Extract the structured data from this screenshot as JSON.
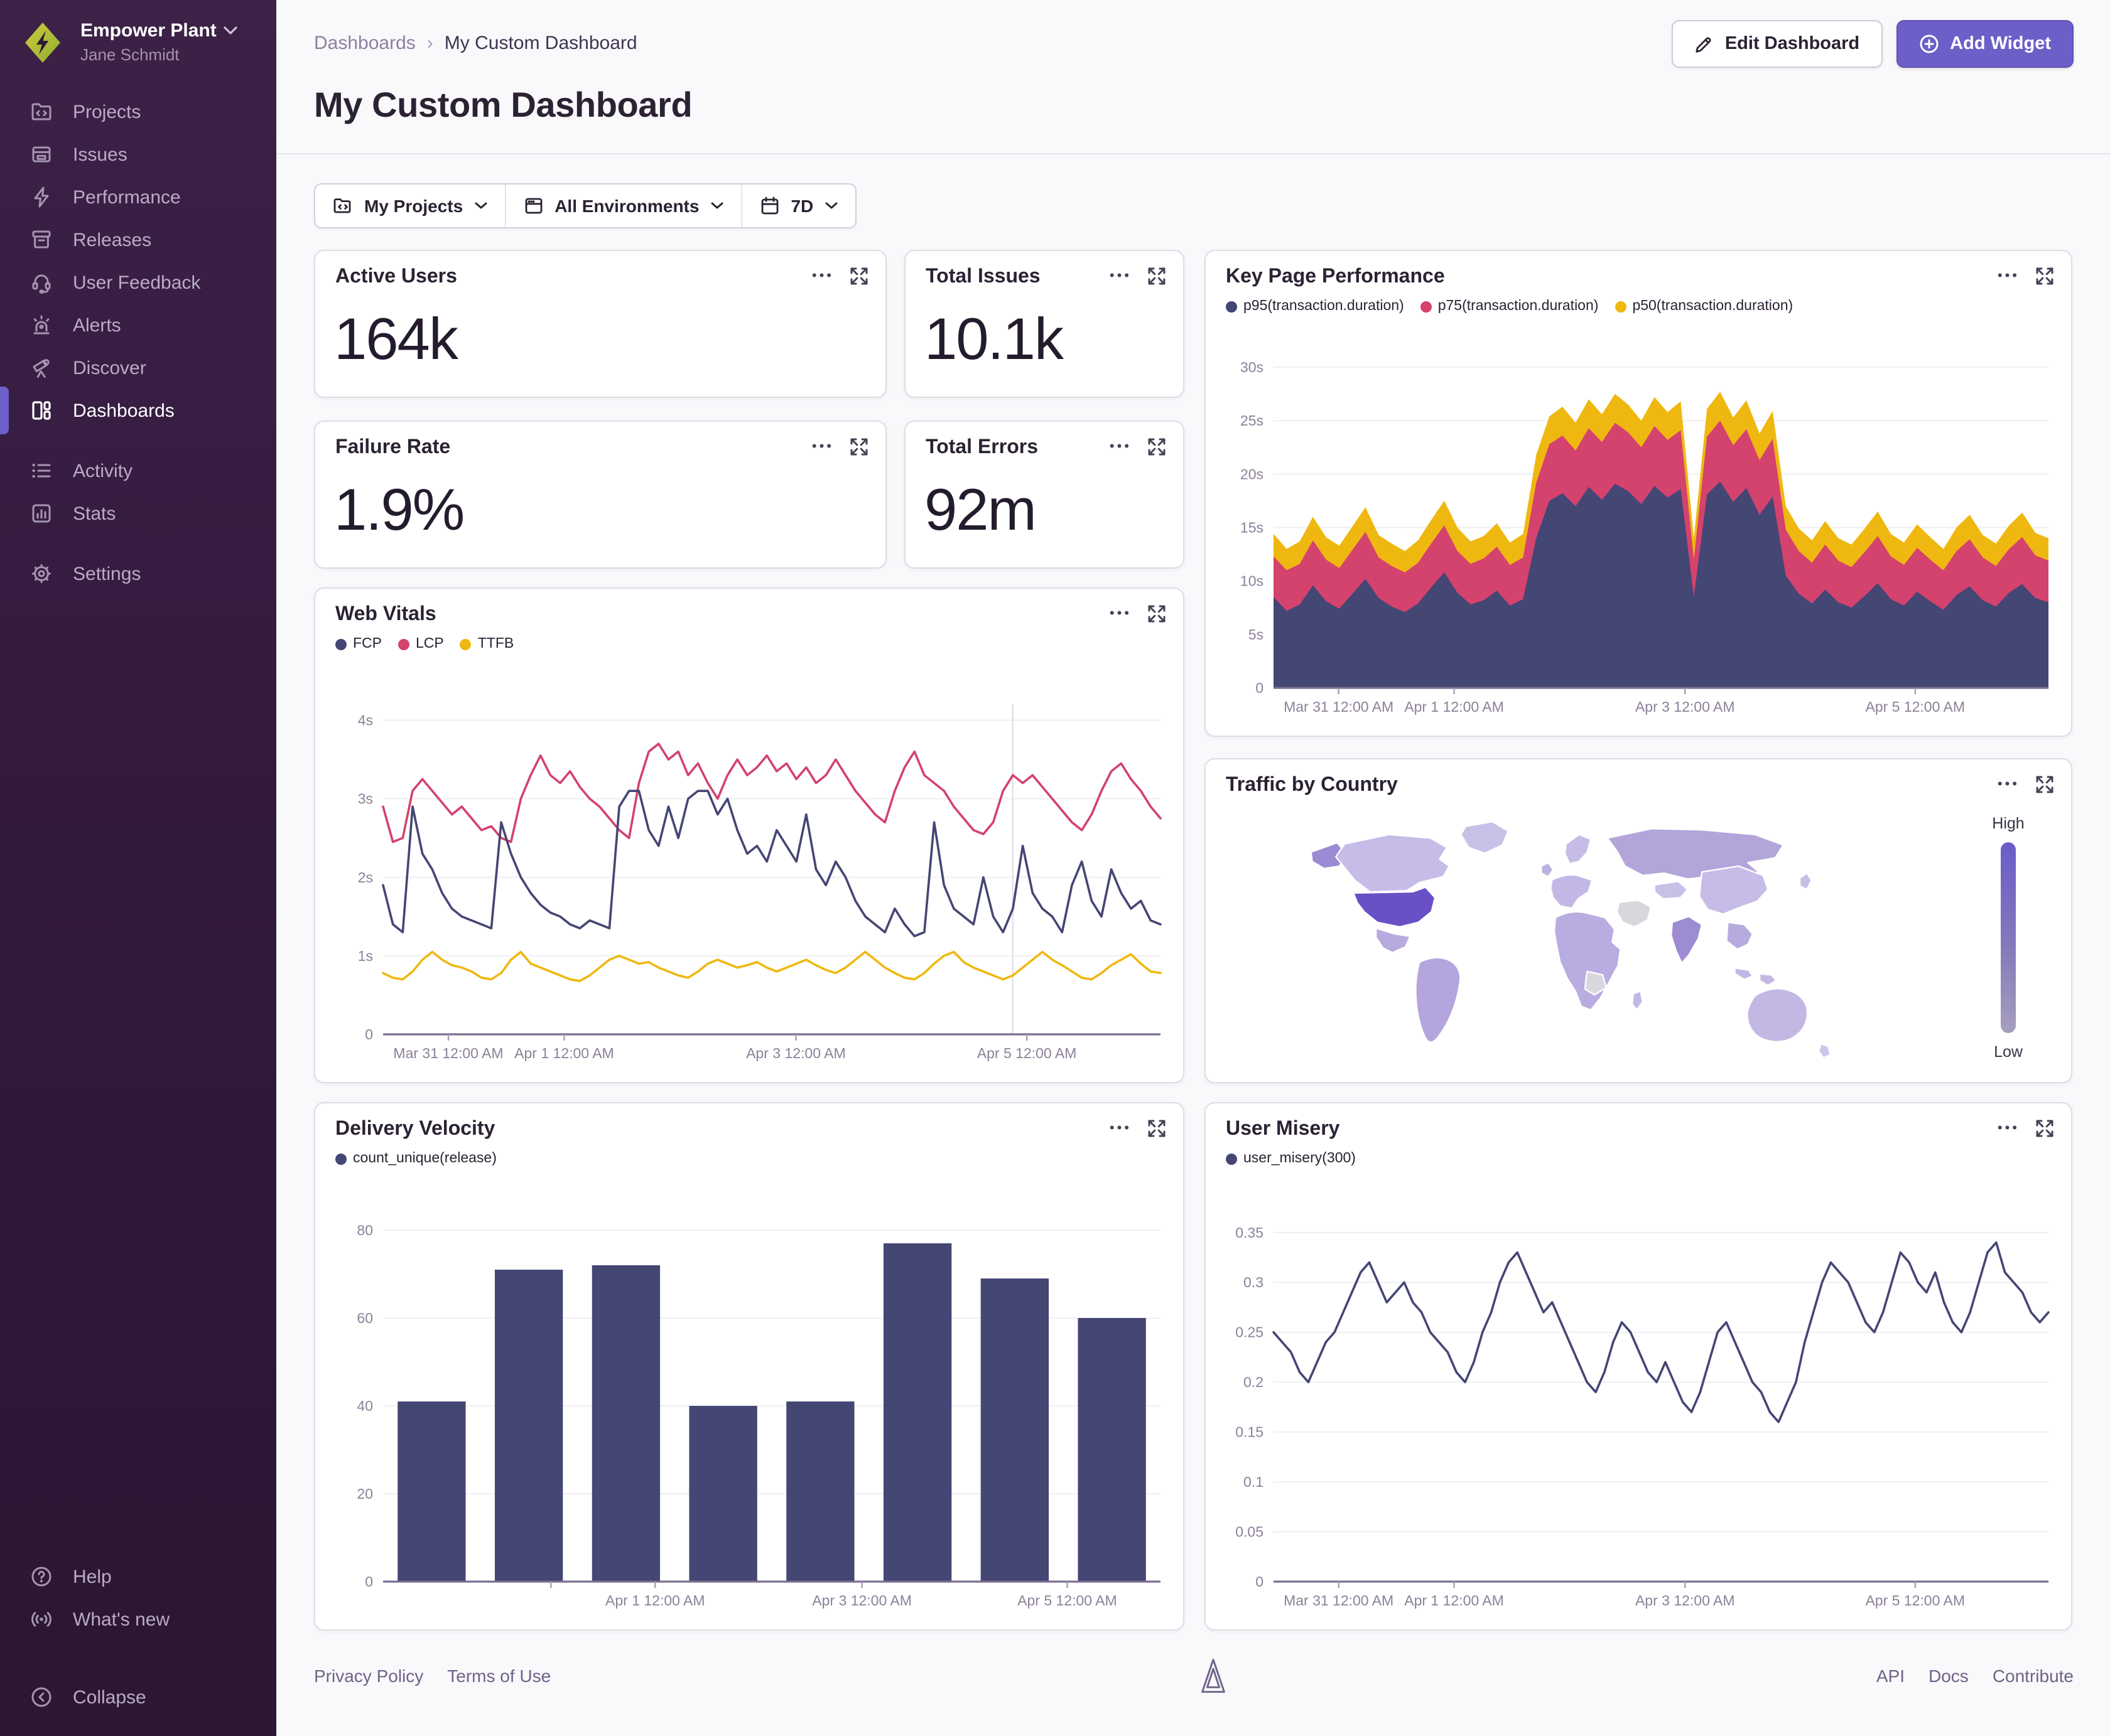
{
  "sidebar": {
    "org": "Empower Plant",
    "user": "Jane Schmidt",
    "items": [
      {
        "label": "Projects"
      },
      {
        "label": "Issues"
      },
      {
        "label": "Performance"
      },
      {
        "label": "Releases"
      },
      {
        "label": "User Feedback"
      },
      {
        "label": "Alerts"
      },
      {
        "label": "Discover"
      },
      {
        "label": "Dashboards"
      },
      {
        "label": "Activity"
      },
      {
        "label": "Stats"
      },
      {
        "label": "Settings"
      }
    ],
    "active_item": "Dashboards",
    "footer_items": [
      {
        "label": "Help"
      },
      {
        "label": "What's new"
      },
      {
        "label": "Collapse"
      }
    ]
  },
  "header": {
    "breadcrumb_parent": "Dashboards",
    "breadcrumb_sep": "›",
    "breadcrumb_current": "My Custom Dashboard",
    "title": "My Custom Dashboard",
    "edit_label": "Edit Dashboard",
    "add_label": "Add Widget"
  },
  "filters": {
    "projects": "My Projects",
    "environments": "All Environments",
    "time": "7D"
  },
  "widgets": {
    "active_users": {
      "title": "Active Users",
      "value": "164k"
    },
    "total_issues": {
      "title": "Total Issues",
      "value": "10.1k"
    },
    "failure_rate": {
      "title": "Failure Rate",
      "value": "1.9%"
    },
    "total_errors": {
      "title": "Total Errors",
      "value": "92m"
    },
    "key_page_performance": {
      "title": "Key Page Performance",
      "legend": [
        "p95(transaction.duration)",
        "p75(transaction.duration)",
        "p50(transaction.duration)"
      ]
    },
    "web_vitals": {
      "title": "Web Vitals",
      "legend": [
        "FCP",
        "LCP",
        "TTFB"
      ]
    },
    "traffic_by_country": {
      "title": "Traffic by Country",
      "legend_high": "High",
      "legend_low": "Low"
    },
    "delivery_velocity": {
      "title": "Delivery Velocity",
      "legend": [
        "count_unique(release)"
      ]
    },
    "user_misery": {
      "title": "User Misery",
      "legend": [
        "user_misery(300)"
      ]
    }
  },
  "footer": {
    "links_left": [
      "Privacy Policy",
      "Terms of Use"
    ],
    "links_right": [
      "API",
      "Docs",
      "Contribute"
    ]
  },
  "colors": {
    "accent": "#6c5fc7",
    "navy": "#444674",
    "pink": "#d4426e",
    "yellow": "#efb810",
    "map_high": "#6a50c7",
    "map_low": "#cdc5ea"
  },
  "chart_data": [
    {
      "id": "key_page_performance",
      "type": "area",
      "title": "Key Page Performance",
      "ylabel": "transaction.duration",
      "ylim": [
        0,
        31
      ],
      "yticks": [
        [
          0,
          "0"
        ],
        [
          5,
          "5s"
        ],
        [
          10,
          "10s"
        ],
        [
          15,
          "15s"
        ],
        [
          20,
          "20s"
        ],
        [
          25,
          "25s"
        ],
        [
          30,
          "30s"
        ]
      ],
      "xticks": [
        [
          0.084,
          "Mar 31 12:00 AM"
        ],
        [
          0.233,
          "Apr 1 12:00 AM"
        ],
        [
          0.531,
          "Apr 3 12:00 AM"
        ],
        [
          0.828,
          "Apr 5 12:00 AM"
        ]
      ],
      "series": [
        {
          "name": "p50(transaction.duration)",
          "color": "#efb810",
          "values": [
            14.4,
            13.0,
            13.7,
            16.0,
            14.1,
            13.3,
            15.1,
            16.9,
            14.3,
            13.5,
            12.8,
            13.8,
            15.7,
            17.5,
            15.0,
            13.7,
            14.2,
            15.4,
            13.6,
            14.4,
            21.8,
            25.4,
            26.3,
            24.8,
            27.0,
            25.6,
            27.5,
            26.5,
            25.0,
            27.2,
            25.8,
            26.8,
            14.0,
            26.1,
            27.7,
            25.3,
            26.9,
            23.8,
            25.9,
            17.0,
            14.9,
            13.8,
            15.6,
            14.0,
            13.4,
            14.9,
            16.5,
            14.4,
            13.6,
            15.3,
            14.1,
            13.0,
            15.0,
            16.2,
            14.3,
            13.5,
            15.2,
            16.4,
            14.5,
            14.0
          ]
        },
        {
          "name": "p75(transaction.duration)",
          "color": "#d4426e",
          "values": [
            12.3,
            11.0,
            11.6,
            13.8,
            12.0,
            11.2,
            12.9,
            14.6,
            12.2,
            11.4,
            10.8,
            11.7,
            13.5,
            15.2,
            12.8,
            11.6,
            12.1,
            13.2,
            11.5,
            12.2,
            19.2,
            22.8,
            23.6,
            22.2,
            24.3,
            23.0,
            24.8,
            23.9,
            22.5,
            24.5,
            23.2,
            24.1,
            12.0,
            23.5,
            25.0,
            22.7,
            24.2,
            21.3,
            23.3,
            14.8,
            12.8,
            11.7,
            13.4,
            11.9,
            11.3,
            12.7,
            14.2,
            12.3,
            11.5,
            13.1,
            12.0,
            11.0,
            12.8,
            13.9,
            12.2,
            11.4,
            13.0,
            14.1,
            12.4,
            11.9
          ]
        },
        {
          "name": "p95(transaction.duration)",
          "color": "#444674",
          "values": [
            8.5,
            7.2,
            7.8,
            9.6,
            8.1,
            7.4,
            8.8,
            10.2,
            8.4,
            7.6,
            7.1,
            7.9,
            9.4,
            10.8,
            8.9,
            7.8,
            8.2,
            9.1,
            7.7,
            8.3,
            14.0,
            17.5,
            18.2,
            17.0,
            18.8,
            17.6,
            19.1,
            18.4,
            17.2,
            18.9,
            17.8,
            18.6,
            8.5,
            18.1,
            19.3,
            17.4,
            18.7,
            16.2,
            17.9,
            10.5,
            8.8,
            7.9,
            9.2,
            8.0,
            7.5,
            8.6,
            9.8,
            8.3,
            7.7,
            9.0,
            8.1,
            7.3,
            8.7,
            9.5,
            8.2,
            7.6,
            8.9,
            9.7,
            8.4,
            8.0
          ]
        }
      ]
    },
    {
      "id": "web_vitals",
      "type": "line",
      "title": "Web Vitals",
      "ylim": [
        0,
        4.3
      ],
      "yticks": [
        [
          0,
          "0"
        ],
        [
          1,
          "1s"
        ],
        [
          2,
          "2s"
        ],
        [
          3,
          "3s"
        ],
        [
          4,
          "4s"
        ]
      ],
      "xticks": [
        [
          0.084,
          "Mar 31 12:00 AM"
        ],
        [
          0.233,
          "Apr 1 12:00 AM"
        ],
        [
          0.531,
          "Apr 3 12:00 AM"
        ],
        [
          0.828,
          "Apr 5 12:00 AM"
        ]
      ],
      "vline": 0.81,
      "series": [
        {
          "name": "LCP",
          "color": "#d4426e",
          "values": [
            2.9,
            2.45,
            2.5,
            3.1,
            3.25,
            3.1,
            2.95,
            2.8,
            2.9,
            2.75,
            2.6,
            2.65,
            2.5,
            2.45,
            3.0,
            3.3,
            3.55,
            3.3,
            3.2,
            3.35,
            3.15,
            3.0,
            2.9,
            2.75,
            2.6,
            2.5,
            3.2,
            3.6,
            3.7,
            3.5,
            3.6,
            3.3,
            3.45,
            3.2,
            3.0,
            3.3,
            3.5,
            3.3,
            3.4,
            3.55,
            3.35,
            3.45,
            3.25,
            3.4,
            3.2,
            3.3,
            3.5,
            3.3,
            3.1,
            2.95,
            2.8,
            2.7,
            3.1,
            3.4,
            3.6,
            3.3,
            3.2,
            3.1,
            2.9,
            2.75,
            2.6,
            2.55,
            2.7,
            3.1,
            3.3,
            3.2,
            3.3,
            3.15,
            3.0,
            2.85,
            2.7,
            2.6,
            2.8,
            3.1,
            3.35,
            3.45,
            3.25,
            3.1,
            2.9,
            2.75
          ]
        },
        {
          "name": "FCP",
          "color": "#444674",
          "values": [
            1.9,
            1.4,
            1.3,
            2.9,
            2.3,
            2.1,
            1.8,
            1.6,
            1.5,
            1.45,
            1.4,
            1.35,
            2.7,
            2.3,
            2.0,
            1.8,
            1.65,
            1.55,
            1.5,
            1.4,
            1.35,
            1.45,
            1.4,
            1.35,
            2.9,
            3.1,
            3.1,
            2.6,
            2.4,
            2.9,
            2.5,
            3.0,
            3.1,
            3.1,
            2.8,
            3.0,
            2.6,
            2.3,
            2.4,
            2.2,
            2.6,
            2.4,
            2.2,
            2.8,
            2.1,
            1.9,
            2.2,
            2.0,
            1.7,
            1.5,
            1.4,
            1.3,
            1.6,
            1.4,
            1.25,
            1.3,
            2.7,
            1.9,
            1.6,
            1.5,
            1.4,
            2.0,
            1.5,
            1.3,
            1.6,
            2.4,
            1.8,
            1.6,
            1.5,
            1.3,
            1.9,
            2.2,
            1.7,
            1.5,
            2.1,
            1.8,
            1.6,
            1.7,
            1.45,
            1.4
          ]
        },
        {
          "name": "TTFB",
          "color": "#efb810",
          "values": [
            0.78,
            0.72,
            0.7,
            0.8,
            0.95,
            1.05,
            0.95,
            0.88,
            0.85,
            0.8,
            0.72,
            0.7,
            0.78,
            0.95,
            1.05,
            0.9,
            0.85,
            0.8,
            0.75,
            0.7,
            0.68,
            0.75,
            0.85,
            0.95,
            1.0,
            0.95,
            0.9,
            0.92,
            0.85,
            0.8,
            0.75,
            0.72,
            0.8,
            0.9,
            0.95,
            0.9,
            0.85,
            0.88,
            0.92,
            0.85,
            0.8,
            0.85,
            0.9,
            0.95,
            0.88,
            0.82,
            0.78,
            0.85,
            0.95,
            1.05,
            0.95,
            0.85,
            0.78,
            0.72,
            0.7,
            0.78,
            0.9,
            1.0,
            1.05,
            0.92,
            0.85,
            0.8,
            0.75,
            0.7,
            0.75,
            0.85,
            0.95,
            1.05,
            0.95,
            0.88,
            0.8,
            0.72,
            0.7,
            0.78,
            0.88,
            0.95,
            1.02,
            0.9,
            0.8,
            0.78
          ]
        }
      ]
    },
    {
      "id": "delivery_velocity",
      "type": "bar",
      "title": "Delivery Velocity",
      "ylim": [
        0,
        84
      ],
      "yticks": [
        [
          0,
          "0"
        ],
        [
          20,
          "20"
        ],
        [
          40,
          "40"
        ],
        [
          60,
          "60"
        ],
        [
          80,
          "80"
        ]
      ],
      "xticks": [
        [
          0.216,
          ""
        ],
        [
          0.35,
          "Apr 1 12:00 AM"
        ],
        [
          0.616,
          "Apr 3 12:00 AM"
        ],
        [
          0.88,
          "Apr 5 12:00 AM"
        ]
      ],
      "series": [
        {
          "name": "count_unique(release)",
          "color": "#444674",
          "values": [
            41,
            71,
            72,
            40,
            41,
            77,
            69,
            60
          ]
        }
      ]
    },
    {
      "id": "user_misery",
      "type": "line",
      "title": "User Misery",
      "ylim": [
        0,
        0.37
      ],
      "yticks": [
        [
          0,
          "0"
        ],
        [
          0.05,
          "0.05"
        ],
        [
          0.1,
          "0.1"
        ],
        [
          0.15,
          "0.15"
        ],
        [
          0.2,
          "0.2"
        ],
        [
          0.25,
          "0.25"
        ],
        [
          0.3,
          "0.3"
        ],
        [
          0.35,
          "0.35"
        ]
      ],
      "xticks": [
        [
          0.084,
          "Mar 31 12:00 AM"
        ],
        [
          0.233,
          "Apr 1 12:00 AM"
        ],
        [
          0.531,
          "Apr 3 12:00 AM"
        ],
        [
          0.828,
          "Apr 5 12:00 AM"
        ]
      ],
      "series": [
        {
          "name": "user_misery(300)",
          "color": "#444674",
          "values": [
            0.25,
            0.24,
            0.23,
            0.21,
            0.2,
            0.22,
            0.24,
            0.25,
            0.27,
            0.29,
            0.31,
            0.32,
            0.3,
            0.28,
            0.29,
            0.3,
            0.28,
            0.27,
            0.25,
            0.24,
            0.23,
            0.21,
            0.2,
            0.22,
            0.25,
            0.27,
            0.3,
            0.32,
            0.33,
            0.31,
            0.29,
            0.27,
            0.28,
            0.26,
            0.24,
            0.22,
            0.2,
            0.19,
            0.21,
            0.24,
            0.26,
            0.25,
            0.23,
            0.21,
            0.2,
            0.22,
            0.2,
            0.18,
            0.17,
            0.19,
            0.22,
            0.25,
            0.26,
            0.24,
            0.22,
            0.2,
            0.19,
            0.17,
            0.16,
            0.18,
            0.2,
            0.24,
            0.27,
            0.3,
            0.32,
            0.31,
            0.3,
            0.28,
            0.26,
            0.25,
            0.27,
            0.3,
            0.33,
            0.32,
            0.3,
            0.29,
            0.31,
            0.28,
            0.26,
            0.25,
            0.27,
            0.3,
            0.33,
            0.34,
            0.31,
            0.3,
            0.29,
            0.27,
            0.26,
            0.27
          ]
        }
      ]
    }
  ]
}
